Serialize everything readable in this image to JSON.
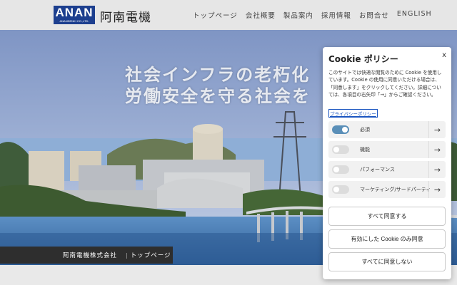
{
  "header": {
    "logo_mark": "ANAN",
    "logo_sub": "ANANDENKI CO.,LTD.",
    "logo_text": "阿南電機",
    "nav": [
      {
        "label": "トップページ"
      },
      {
        "label": "会社概要"
      },
      {
        "label": "製品案内"
      },
      {
        "label": "採用情報"
      },
      {
        "label": "お問合せ"
      },
      {
        "label": "ENGLISH"
      }
    ]
  },
  "hero": {
    "line1": "社会インフラの老朽化",
    "line2": "労働安全を守る社会を"
  },
  "breadcrumb": {
    "company": "阿南電機株式会社",
    "current": "トップページ"
  },
  "cookie": {
    "title": "Cookie ポリシー",
    "close": "x",
    "description": "このサイトでは快適な閲覧のために Cookie を使用しています。Cookie の使用に同意いただける場合は、「同意します」をクリックしてください。詳細については、各項目の右矢印「→」からご確認ください。",
    "privacy_link": "プライバシーポリシー",
    "categories": [
      {
        "label": "必須",
        "enabled": true
      },
      {
        "label": "機能",
        "enabled": false
      },
      {
        "label": "パフォーマンス",
        "enabled": false
      },
      {
        "label": "マーケティング/サードパーティ",
        "enabled": false
      }
    ],
    "buttons": {
      "accept_all": "すべて同意する",
      "accept_selected": "有効にした Cookie のみ同意",
      "reject_all": "すべてに同意しない"
    },
    "colors": {
      "toggle_on": "#5a8fb8",
      "link": "#1a55c0"
    }
  }
}
